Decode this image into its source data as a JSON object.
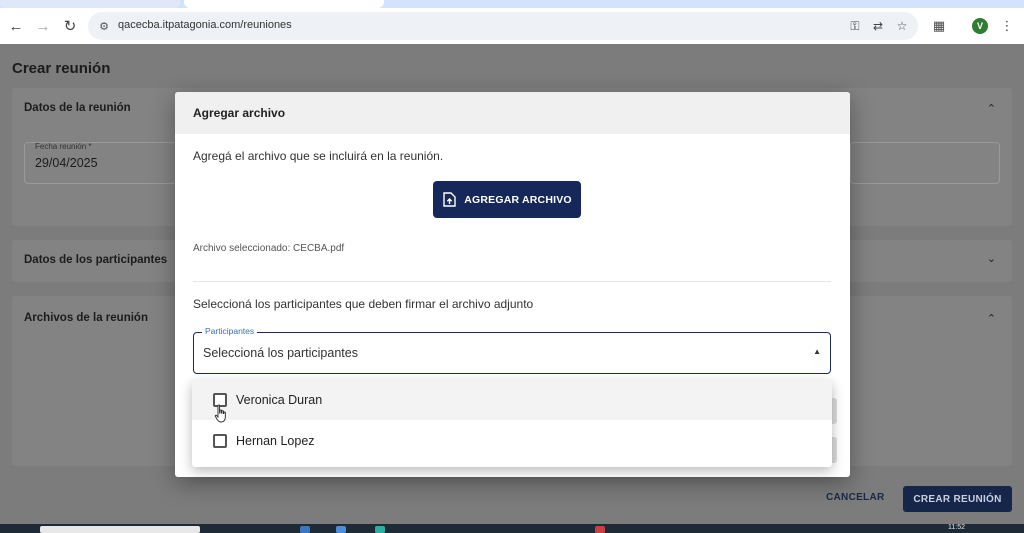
{
  "browser": {
    "url": "qacecba.itpatagonia.com/reuniones",
    "profile_initial": "V"
  },
  "page": {
    "title": "Crear reunión",
    "sections": {
      "meeting_data": {
        "title": "Datos de la reunión",
        "date_label": "Fecha reunión *",
        "date_value": "29/04/2025"
      },
      "participants": {
        "title": "Datos de los participantes"
      },
      "files": {
        "title": "Archivos de la reunión"
      }
    },
    "actions": {
      "cancel_label": "CANCELAR",
      "create_label": "CREAR REUNIÓN"
    }
  },
  "modal": {
    "title": "Agregar archivo",
    "description": "Agregá el archivo que se incluirá en la reunión.",
    "add_button_label": "AGREGAR ARCHIVO",
    "selected_file": "Archivo seleccionado: CECBA.pdf",
    "sign_description": "Seleccioná los participantes que deben firmar el archivo adjunto",
    "participants_field": {
      "label": "Participantes",
      "placeholder": "Seleccioná los participantes"
    }
  },
  "dropdown": {
    "options": [
      {
        "label": "Veronica Duran",
        "checked": false,
        "hovered": true
      },
      {
        "label": "Hernan Lopez",
        "checked": false,
        "hovered": false
      }
    ]
  },
  "taskbar": {
    "clock": "11:52"
  },
  "colors": {
    "primary": "#16285a",
    "select_border": "#1d2d52",
    "label_blue": "#3a6fb0",
    "overlay": "#7c7c7c"
  }
}
